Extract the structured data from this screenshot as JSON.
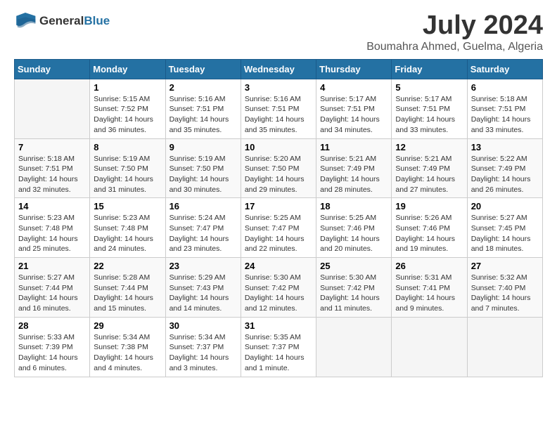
{
  "logo": {
    "general": "General",
    "blue": "Blue"
  },
  "title": {
    "month_year": "July 2024",
    "location": "Boumahra Ahmed, Guelma, Algeria"
  },
  "weekdays": [
    "Sunday",
    "Monday",
    "Tuesday",
    "Wednesday",
    "Thursday",
    "Friday",
    "Saturday"
  ],
  "weeks": [
    [
      {
        "day": "",
        "info": ""
      },
      {
        "day": "1",
        "info": "Sunrise: 5:15 AM\nSunset: 7:52 PM\nDaylight: 14 hours\nand 36 minutes."
      },
      {
        "day": "2",
        "info": "Sunrise: 5:16 AM\nSunset: 7:51 PM\nDaylight: 14 hours\nand 35 minutes."
      },
      {
        "day": "3",
        "info": "Sunrise: 5:16 AM\nSunset: 7:51 PM\nDaylight: 14 hours\nand 35 minutes."
      },
      {
        "day": "4",
        "info": "Sunrise: 5:17 AM\nSunset: 7:51 PM\nDaylight: 14 hours\nand 34 minutes."
      },
      {
        "day": "5",
        "info": "Sunrise: 5:17 AM\nSunset: 7:51 PM\nDaylight: 14 hours\nand 33 minutes."
      },
      {
        "day": "6",
        "info": "Sunrise: 5:18 AM\nSunset: 7:51 PM\nDaylight: 14 hours\nand 33 minutes."
      }
    ],
    [
      {
        "day": "7",
        "info": "Sunrise: 5:18 AM\nSunset: 7:51 PM\nDaylight: 14 hours\nand 32 minutes."
      },
      {
        "day": "8",
        "info": "Sunrise: 5:19 AM\nSunset: 7:50 PM\nDaylight: 14 hours\nand 31 minutes."
      },
      {
        "day": "9",
        "info": "Sunrise: 5:19 AM\nSunset: 7:50 PM\nDaylight: 14 hours\nand 30 minutes."
      },
      {
        "day": "10",
        "info": "Sunrise: 5:20 AM\nSunset: 7:50 PM\nDaylight: 14 hours\nand 29 minutes."
      },
      {
        "day": "11",
        "info": "Sunrise: 5:21 AM\nSunset: 7:49 PM\nDaylight: 14 hours\nand 28 minutes."
      },
      {
        "day": "12",
        "info": "Sunrise: 5:21 AM\nSunset: 7:49 PM\nDaylight: 14 hours\nand 27 minutes."
      },
      {
        "day": "13",
        "info": "Sunrise: 5:22 AM\nSunset: 7:49 PM\nDaylight: 14 hours\nand 26 minutes."
      }
    ],
    [
      {
        "day": "14",
        "info": "Sunrise: 5:23 AM\nSunset: 7:48 PM\nDaylight: 14 hours\nand 25 minutes."
      },
      {
        "day": "15",
        "info": "Sunrise: 5:23 AM\nSunset: 7:48 PM\nDaylight: 14 hours\nand 24 minutes."
      },
      {
        "day": "16",
        "info": "Sunrise: 5:24 AM\nSunset: 7:47 PM\nDaylight: 14 hours\nand 23 minutes."
      },
      {
        "day": "17",
        "info": "Sunrise: 5:25 AM\nSunset: 7:47 PM\nDaylight: 14 hours\nand 22 minutes."
      },
      {
        "day": "18",
        "info": "Sunrise: 5:25 AM\nSunset: 7:46 PM\nDaylight: 14 hours\nand 20 minutes."
      },
      {
        "day": "19",
        "info": "Sunrise: 5:26 AM\nSunset: 7:46 PM\nDaylight: 14 hours\nand 19 minutes."
      },
      {
        "day": "20",
        "info": "Sunrise: 5:27 AM\nSunset: 7:45 PM\nDaylight: 14 hours\nand 18 minutes."
      }
    ],
    [
      {
        "day": "21",
        "info": "Sunrise: 5:27 AM\nSunset: 7:44 PM\nDaylight: 14 hours\nand 16 minutes."
      },
      {
        "day": "22",
        "info": "Sunrise: 5:28 AM\nSunset: 7:44 PM\nDaylight: 14 hours\nand 15 minutes."
      },
      {
        "day": "23",
        "info": "Sunrise: 5:29 AM\nSunset: 7:43 PM\nDaylight: 14 hours\nand 14 minutes."
      },
      {
        "day": "24",
        "info": "Sunrise: 5:30 AM\nSunset: 7:42 PM\nDaylight: 14 hours\nand 12 minutes."
      },
      {
        "day": "25",
        "info": "Sunrise: 5:30 AM\nSunset: 7:42 PM\nDaylight: 14 hours\nand 11 minutes."
      },
      {
        "day": "26",
        "info": "Sunrise: 5:31 AM\nSunset: 7:41 PM\nDaylight: 14 hours\nand 9 minutes."
      },
      {
        "day": "27",
        "info": "Sunrise: 5:32 AM\nSunset: 7:40 PM\nDaylight: 14 hours\nand 7 minutes."
      }
    ],
    [
      {
        "day": "28",
        "info": "Sunrise: 5:33 AM\nSunset: 7:39 PM\nDaylight: 14 hours\nand 6 minutes."
      },
      {
        "day": "29",
        "info": "Sunrise: 5:34 AM\nSunset: 7:38 PM\nDaylight: 14 hours\nand 4 minutes."
      },
      {
        "day": "30",
        "info": "Sunrise: 5:34 AM\nSunset: 7:37 PM\nDaylight: 14 hours\nand 3 minutes."
      },
      {
        "day": "31",
        "info": "Sunrise: 5:35 AM\nSunset: 7:37 PM\nDaylight: 14 hours\nand 1 minute."
      },
      {
        "day": "",
        "info": ""
      },
      {
        "day": "",
        "info": ""
      },
      {
        "day": "",
        "info": ""
      }
    ]
  ]
}
